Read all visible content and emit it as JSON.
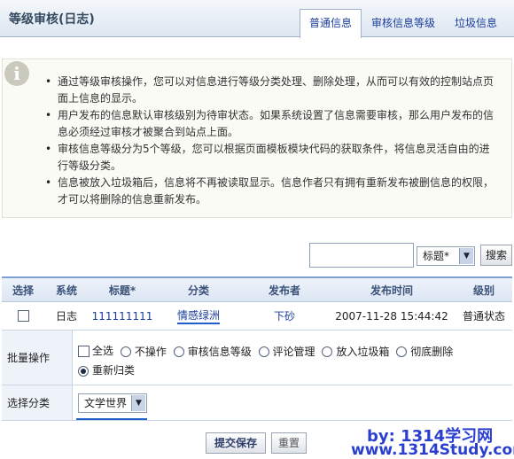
{
  "page": {
    "title": "等级审核(日志)",
    "tabs": [
      {
        "label": "普通信息",
        "active": true
      },
      {
        "label": "审核信息等级",
        "active": false
      },
      {
        "label": "垃圾信息",
        "active": false
      }
    ]
  },
  "info": {
    "icon": "info-icon",
    "items": [
      "通过等级审核操作，您可以对信息进行等级分类处理、删除处理，从而可以有效的控制站点页面上信息的显示。",
      "用户发布的信息默认审核级别为待审状态。如果系统设置了信息需要审核，那么用户发布的信息必须经过审核才被聚合到站点上面。",
      "审核信息等级分为5个等级，您可以根据页面模板模块代码的获取条件，将信息灵活自由的进行等级分类。",
      "信息被放入垃圾箱后，信息将不再被读取显示。信息作者只有拥有重新发布被删信息的权限，才可以将删除的信息重新发布。"
    ]
  },
  "search": {
    "input_value": "",
    "field_selected": "标题*",
    "button_label": "搜索"
  },
  "table": {
    "headers": [
      "选择",
      "系统",
      "标题*",
      "分类",
      "发布者",
      "发布时间",
      "级别"
    ],
    "rows": [
      {
        "system": "日志",
        "title": "111111111",
        "category": "情感绿洲",
        "author": "下砂",
        "time": "2007-11-28 15:44:42",
        "level": "普通状态"
      }
    ]
  },
  "batch": {
    "label": "批量操作",
    "select_all": "全选",
    "options": [
      "不操作",
      "审核信息等级",
      "评论管理",
      "放入垃圾箱",
      "彻底删除",
      "重新归类"
    ],
    "selected": "重新归类"
  },
  "category": {
    "label": "选择分类",
    "selected": "文学世界"
  },
  "buttons": {
    "submit": "提交保存",
    "reset": "重置"
  },
  "watermark": {
    "line1": "by: 1314学习网",
    "line2": "www.1314Study.com"
  },
  "colors": {
    "accent": "#1e5fc8",
    "link": "#1a3d9c",
    "header_bg": "#dde6f1"
  }
}
